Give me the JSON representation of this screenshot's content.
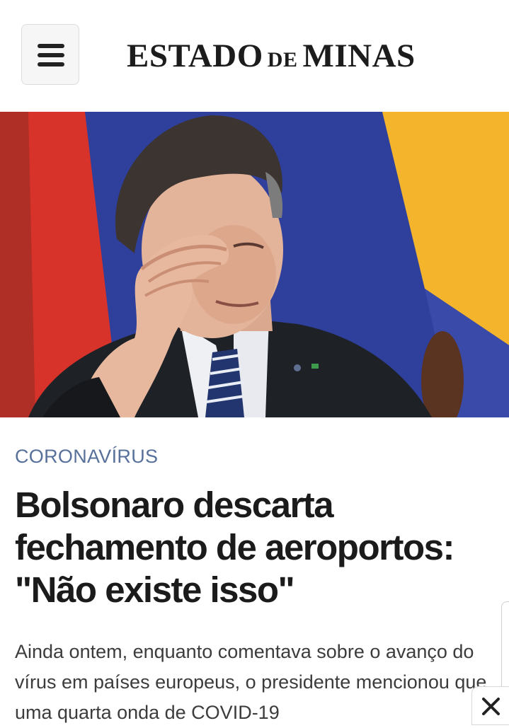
{
  "header": {
    "menu_icon": "hamburger-menu-icon",
    "logo": {
      "part1": "ESTADO",
      "part2": "DE",
      "part3": "MINAS"
    }
  },
  "article": {
    "category": "CORONAVÍRUS",
    "headline": "Bolsonaro descarta fechamento de aeroportos: \"Não existe isso\"",
    "lead": "Ainda ontem, enquanto comentava sobre o avanço do vírus em países europeus, o presidente mencionou que uma quarta onda de COVID-19"
  },
  "overlay": {
    "close_icon": "close-icon"
  },
  "colors": {
    "category": "#58719a",
    "headline": "#1b1b1b",
    "flag_blue": "#2f3f9c",
    "flag_red": "#d8332a",
    "flag_yellow": "#f4b52c"
  }
}
